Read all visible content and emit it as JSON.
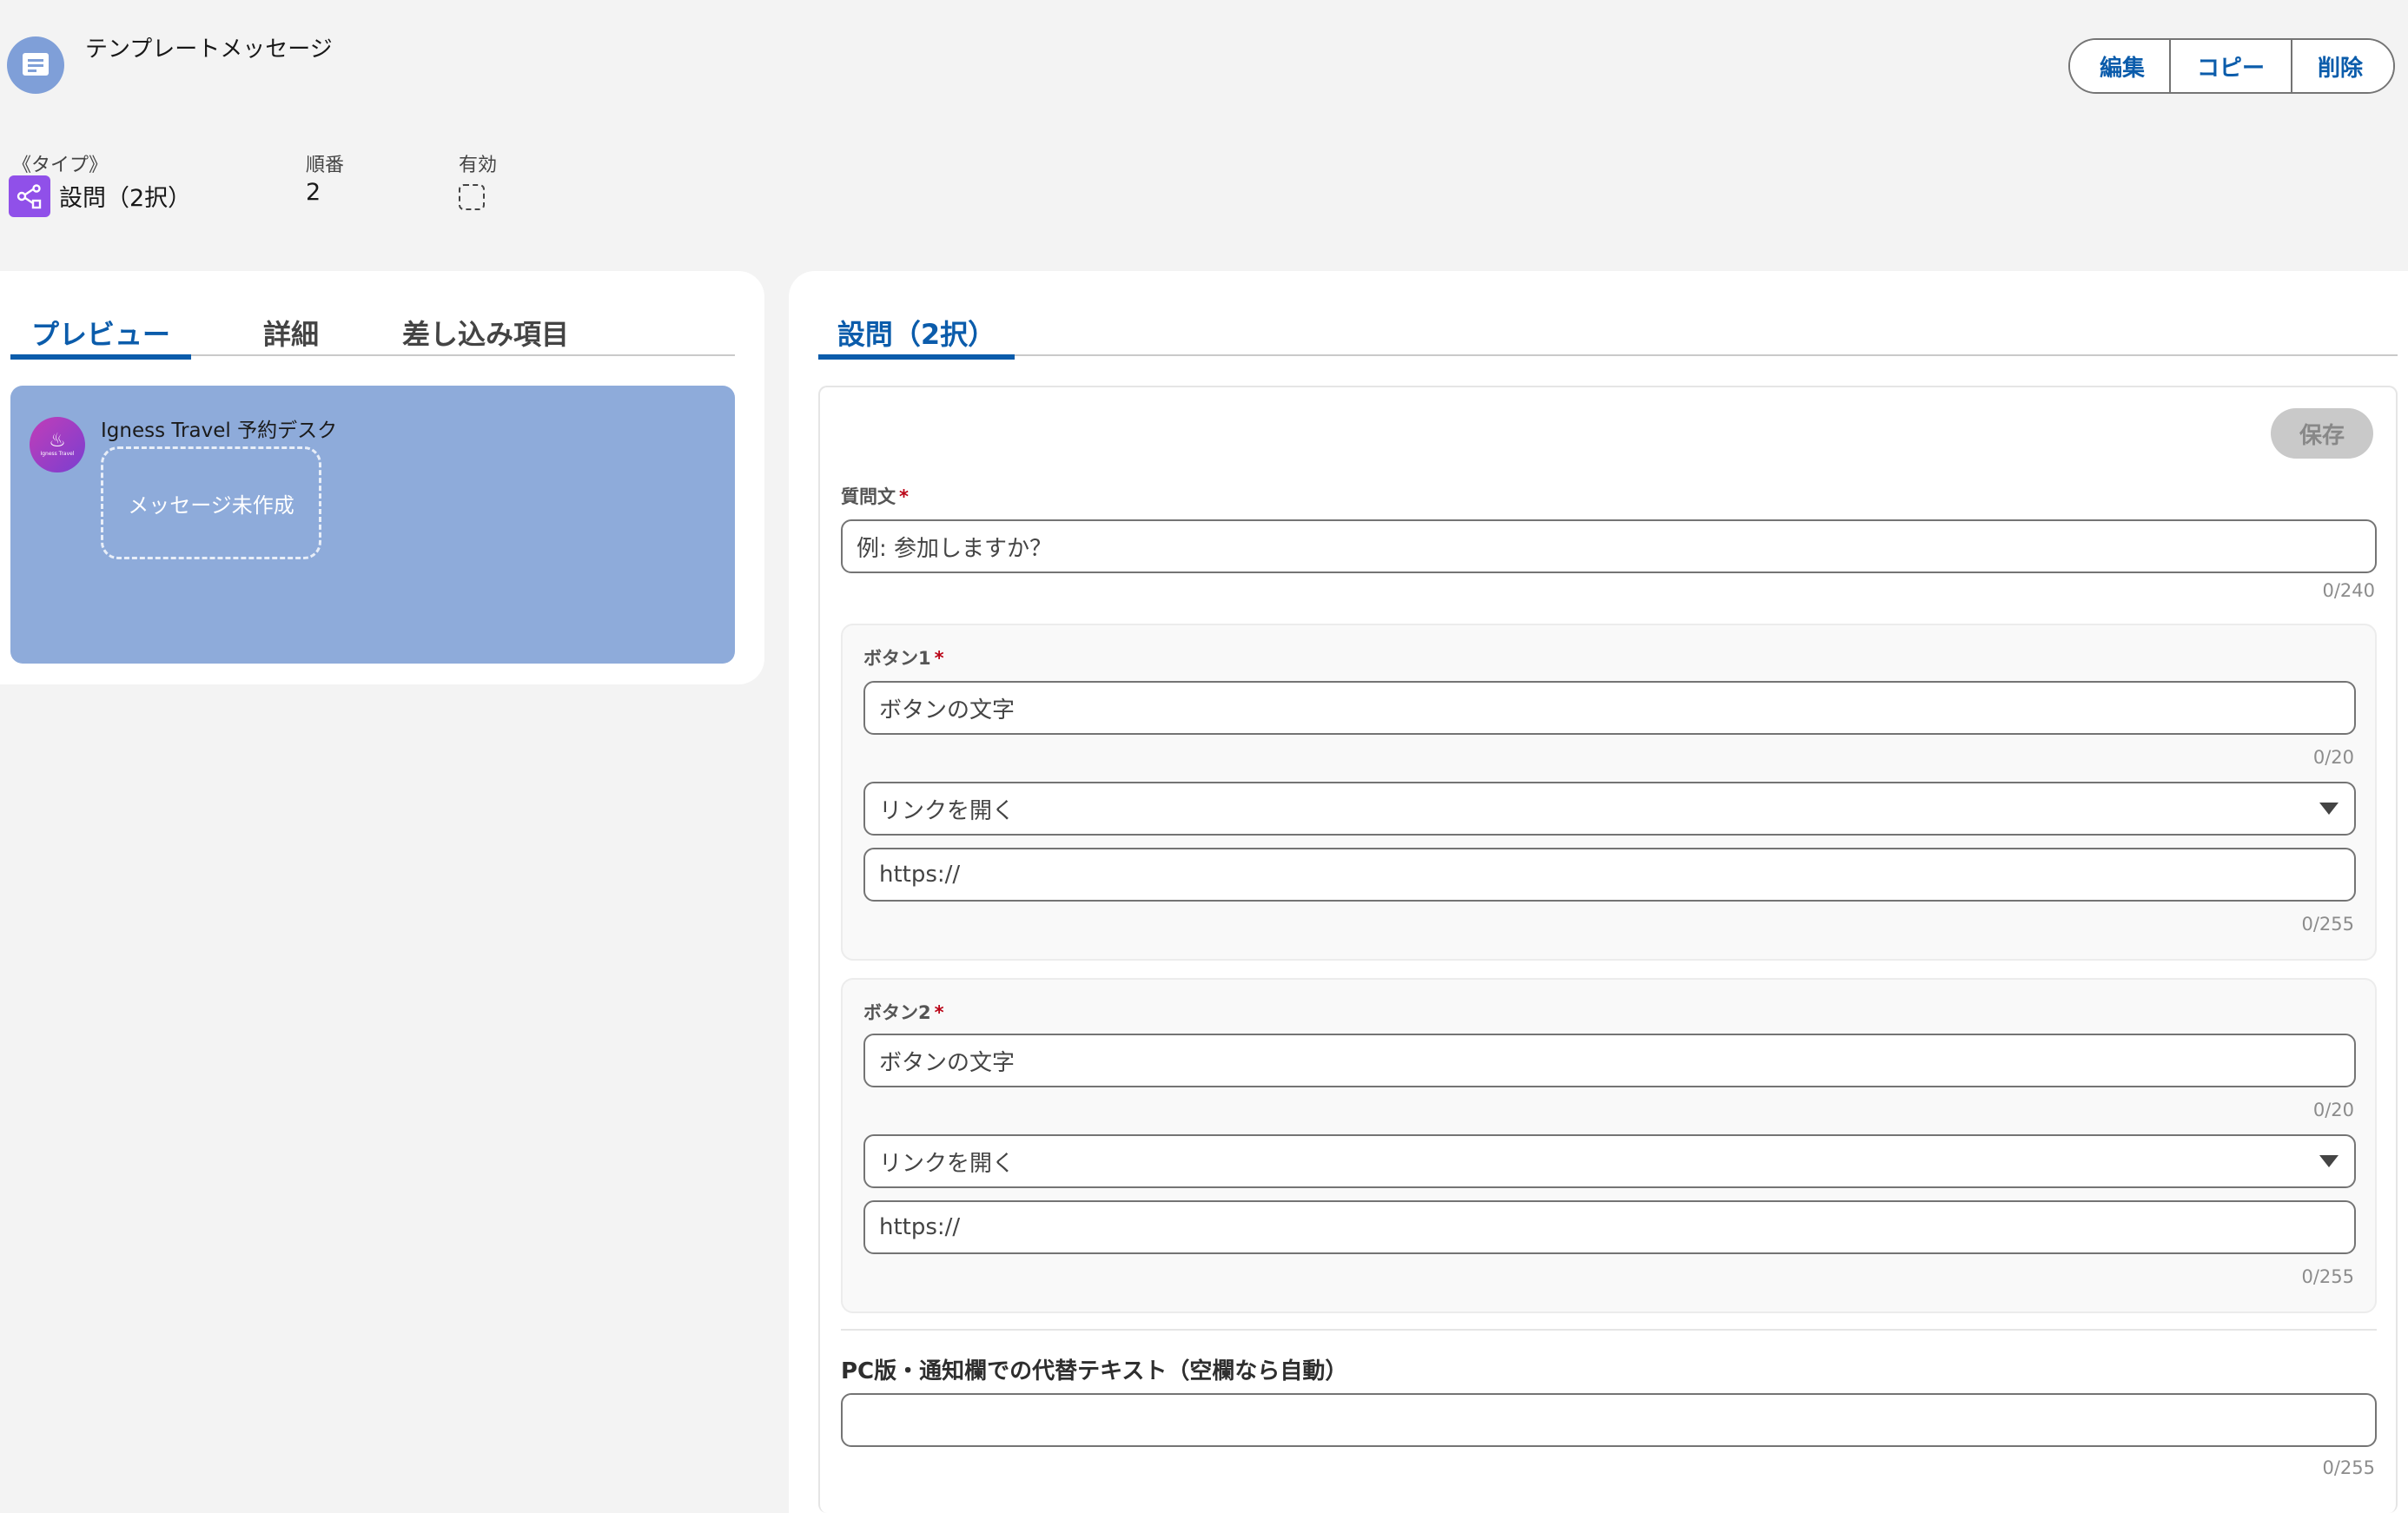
{
  "header": {
    "icon": "template-message-icon",
    "title": "テンプレートメッセージ",
    "actions": {
      "edit": "編集",
      "copy": "コピー",
      "delete": "削除"
    }
  },
  "fields": {
    "type": {
      "label": "《タイプ》",
      "value": "設問（2択）",
      "icon": "branch-icon"
    },
    "order": {
      "label": "順番",
      "value": "2"
    },
    "active": {
      "label": "有効",
      "checked": false
    }
  },
  "left_tabs": [
    "プレビュー",
    "詳細",
    "差し込み項目"
  ],
  "preview": {
    "sender": "Igness Travel 予約デスク",
    "avatar_brand": "Igness Travel",
    "avatar_glyph": "♨",
    "bubble": "メッセージ未作成"
  },
  "right_tab": "設問（2択）",
  "form": {
    "save": "保存",
    "question": {
      "label": "質問文",
      "placeholder": "例: 参加しますか？",
      "count": "0/240"
    },
    "button1": {
      "label": "ボタン1",
      "text_placeholder": "ボタンの文字",
      "text_count": "0/20",
      "action": "リンクを開く",
      "url_placeholder": "https://",
      "url_count": "0/255"
    },
    "button2": {
      "label": "ボタン2",
      "text_placeholder": "ボタンの文字",
      "text_count": "0/20",
      "action": "リンクを開く",
      "url_placeholder": "https://",
      "url_count": "0/255"
    },
    "alt_text": {
      "label": "PC版・通知欄での代替テキスト（空欄なら自動）",
      "value": "",
      "count": "0/255"
    }
  }
}
